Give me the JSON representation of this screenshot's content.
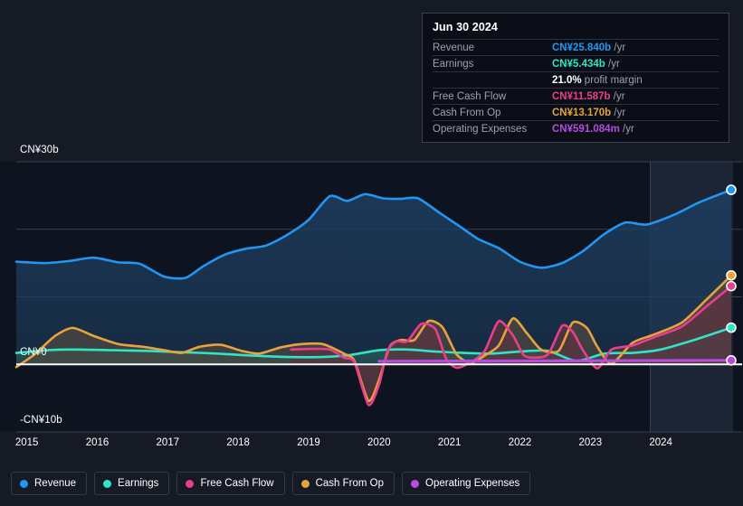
{
  "tooltip": {
    "title": "Jun 30 2024",
    "rows": [
      {
        "key": "Revenue",
        "value": "CN¥25.840b",
        "unit": "/yr",
        "color": "#2196f3"
      },
      {
        "key": "Earnings",
        "value": "CN¥5.434b",
        "unit": "/yr",
        "color": "#2ee6c5"
      },
      {
        "key": "",
        "value": "21.0%",
        "unit": "profit margin",
        "color": "#ffffff"
      },
      {
        "key": "Free Cash Flow",
        "value": "CN¥11.587b",
        "unit": "/yr",
        "color": "#e83e8c"
      },
      {
        "key": "Cash From Op",
        "value": "CN¥13.170b",
        "unit": "/yr",
        "color": "#e8a33d"
      },
      {
        "key": "Operating Expenses",
        "value": "CN¥591.084m",
        "unit": "/yr",
        "color": "#b44de0"
      }
    ]
  },
  "legend": {
    "items": [
      {
        "label": "Revenue",
        "color": "#2196f3"
      },
      {
        "label": "Earnings",
        "color": "#2ee6c5"
      },
      {
        "label": "Free Cash Flow",
        "color": "#e83e8c"
      },
      {
        "label": "Cash From Op",
        "color": "#e8a33d"
      },
      {
        "label": "Operating Expenses",
        "color": "#b44de0"
      }
    ]
  },
  "chart_data": {
    "type": "area",
    "title": "",
    "xlabel": "",
    "ylabel": "",
    "currency": "CN¥",
    "ylim": [
      -10,
      30
    ],
    "yticks": [
      30,
      20,
      10,
      0,
      -10
    ],
    "ytick_labels": [
      "CN¥30b",
      "",
      "",
      "CN¥0",
      "-CN¥10b"
    ],
    "xticks": [
      2015,
      2016,
      2017,
      2018,
      2019,
      2020,
      2021,
      2022,
      2023,
      2024
    ],
    "xtick_labels": [
      "2015",
      "2016",
      "2017",
      "2018",
      "2019",
      "2020",
      "2021",
      "2022",
      "2023",
      "2024"
    ],
    "grid": true,
    "legend_position": "bottom",
    "forecast_start": 2023.35,
    "x_domain": [
      2014.35,
      2024.5
    ],
    "series": [
      {
        "name": "Revenue",
        "color": "#2196f3",
        "fill": "#1d3c5c",
        "x": [
          2014.35,
          2014.75,
          2015.1,
          2015.45,
          2015.8,
          2016.1,
          2016.45,
          2016.75,
          2017.0,
          2017.3,
          2017.6,
          2017.9,
          2018.2,
          2018.5,
          2018.8,
          2019.05,
          2019.3,
          2019.55,
          2019.8,
          2020.05,
          2020.35,
          2020.65,
          2020.9,
          2021.2,
          2021.5,
          2021.8,
          2022.1,
          2022.4,
          2022.7,
          2023.0,
          2023.3,
          2023.7,
          2024.05,
          2024.5
        ],
        "values": [
          15.2,
          15.0,
          15.3,
          15.8,
          15.1,
          14.9,
          13.0,
          12.8,
          14.5,
          16.2,
          17.1,
          17.6,
          19.2,
          21.4,
          24.9,
          24.2,
          25.2,
          24.6,
          24.5,
          24.6,
          22.5,
          20.4,
          18.6,
          17.2,
          15.2,
          14.3,
          15.0,
          16.8,
          19.3,
          21.0,
          20.7,
          22.2,
          24.0,
          25.84
        ]
      },
      {
        "name": "Earnings",
        "color": "#2ee6c5",
        "fill": "#2c5f5a",
        "x": [
          2014.35,
          2014.8,
          2015.2,
          2015.7,
          2016.2,
          2016.7,
          2017.2,
          2017.7,
          2018.2,
          2018.7,
          2019.1,
          2019.5,
          2019.9,
          2020.3,
          2020.7,
          2021.1,
          2021.5,
          2021.9,
          2022.3,
          2022.7,
          2023.1,
          2023.5,
          2024.0,
          2024.5
        ],
        "values": [
          1.7,
          2.1,
          2.2,
          2.1,
          2.0,
          1.8,
          1.6,
          1.3,
          1.1,
          1.1,
          1.4,
          2.1,
          2.2,
          1.9,
          1.7,
          1.6,
          1.9,
          2.0,
          0.5,
          1.6,
          1.7,
          2.2,
          3.7,
          5.434
        ]
      },
      {
        "name": "Free Cash Flow",
        "color": "#e83e8c",
        "fill": "#5a3440",
        "x": [
          2018.25,
          2018.55,
          2018.8,
          2019.0,
          2019.15,
          2019.35,
          2019.5,
          2019.62,
          2019.75,
          2019.9,
          2020.1,
          2020.3,
          2020.45,
          2020.6,
          2020.8,
          2021.0,
          2021.2,
          2021.4,
          2021.55,
          2021.7,
          2021.9,
          2022.1,
          2022.25,
          2022.4,
          2022.6,
          2022.8,
          2023.1,
          2023.4,
          2023.8,
          2024.15,
          2024.5
        ],
        "values": [
          2.2,
          2.3,
          2.2,
          1.0,
          0.3,
          -6.0,
          -3.0,
          2.0,
          3.4,
          3.4,
          6.0,
          5.2,
          0.9,
          -0.5,
          0.3,
          2.0,
          6.4,
          4.3,
          1.4,
          1.0,
          1.5,
          5.7,
          4.8,
          2.0,
          -0.6,
          2.2,
          2.8,
          4.0,
          5.6,
          8.6,
          11.587
        ]
      },
      {
        "name": "Cash From Op",
        "color": "#e8a33d",
        "fill": "#4d4740",
        "x": [
          2014.35,
          2014.6,
          2014.9,
          2015.15,
          2015.45,
          2015.8,
          2016.15,
          2016.45,
          2016.7,
          2016.95,
          2017.25,
          2017.55,
          2017.8,
          2018.1,
          2018.4,
          2018.7,
          2019.0,
          2019.15,
          2019.35,
          2019.5,
          2019.65,
          2019.8,
          2020.0,
          2020.2,
          2020.4,
          2020.6,
          2020.8,
          2021.0,
          2021.2,
          2021.4,
          2021.6,
          2021.8,
          2022.05,
          2022.25,
          2022.45,
          2022.6,
          2022.8,
          2023.1,
          2023.4,
          2023.8,
          2024.15,
          2024.5
        ],
        "values": [
          -0.4,
          1.4,
          4.2,
          5.4,
          4.2,
          3.0,
          2.6,
          2.1,
          1.7,
          2.6,
          2.9,
          2.0,
          1.6,
          2.5,
          3.0,
          3.0,
          1.6,
          0.5,
          -5.4,
          -2.3,
          2.6,
          3.6,
          3.6,
          6.4,
          5.5,
          1.5,
          0.2,
          1.3,
          2.8,
          6.8,
          4.6,
          2.2,
          2.0,
          6.2,
          5.4,
          2.6,
          0.1,
          3.2,
          4.4,
          6.2,
          9.6,
          13.17
        ]
      },
      {
        "name": "Operating Expenses",
        "color": "#b44de0",
        "fill": "none",
        "x": [
          2019.5,
          2024.5
        ],
        "values": [
          0.45,
          0.591
        ]
      }
    ]
  }
}
